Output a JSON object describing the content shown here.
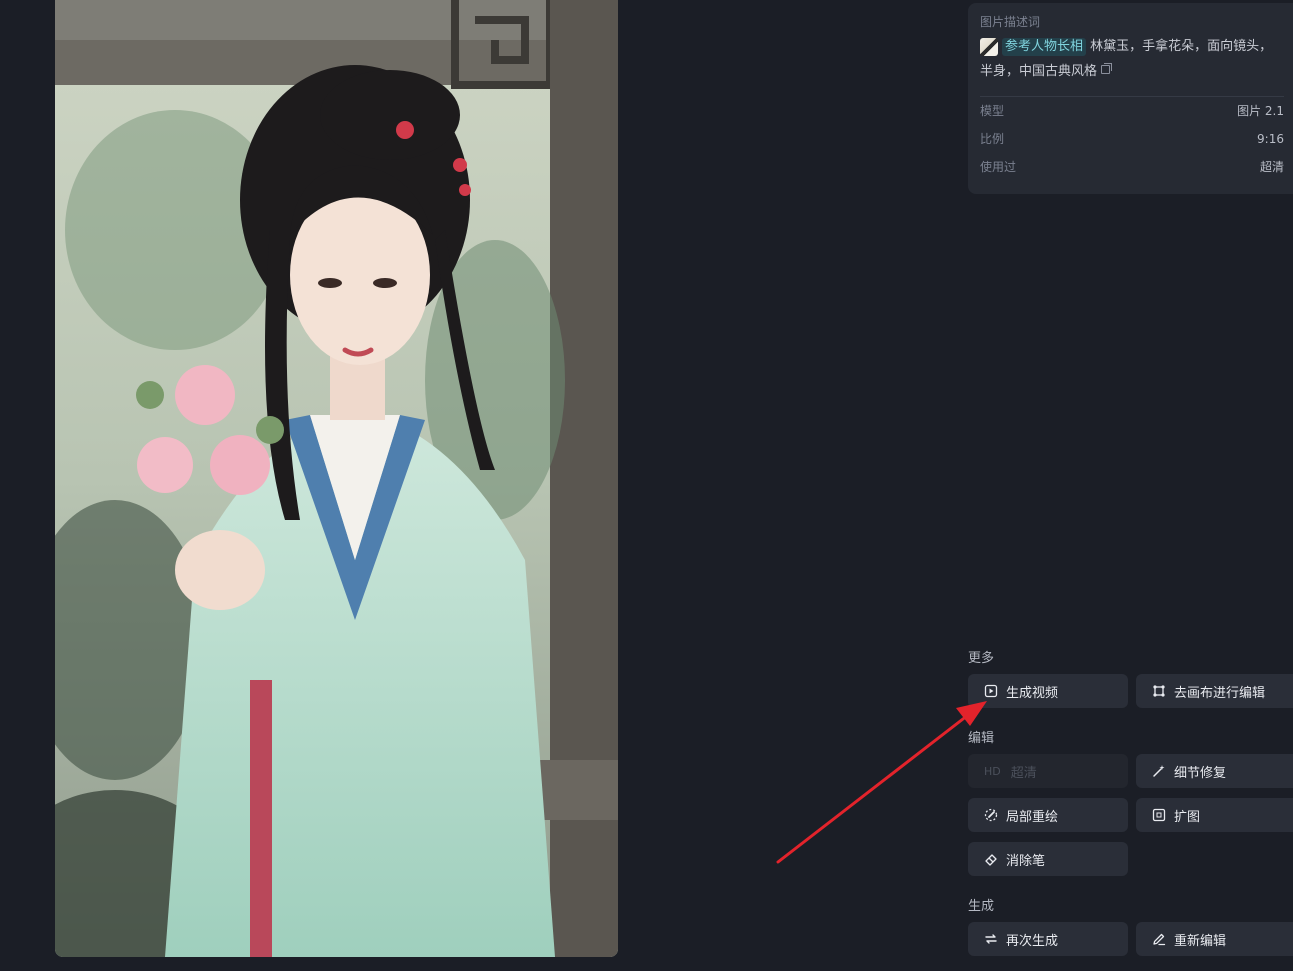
{
  "info": {
    "prompt_caption": "图片描述词",
    "reference_label": "参考人物长相",
    "prompt_line1": "林黛玉，手拿花朵，面向镜头，",
    "prompt_line2": "半身，中国古典风格",
    "rows": [
      {
        "label": "模型",
        "value": "图片 2.1"
      },
      {
        "label": "比例",
        "value": "9:16"
      },
      {
        "label": "使用过",
        "value": "超清"
      }
    ]
  },
  "sections": {
    "more": "更多",
    "edit": "编辑",
    "generate": "生成"
  },
  "buttons": {
    "generate_video": "生成视频",
    "canvas_edit": "去画布进行编辑",
    "hd_badge": "HD",
    "upscale": "超清",
    "detail_fix": "细节修复",
    "inpaint": "局部重绘",
    "outpaint": "扩图",
    "eraser": "消除笔",
    "regenerate": "再次生成",
    "re_edit": "重新编辑"
  },
  "colors": {
    "background": "#1b1e26",
    "card": "#262a33",
    "button": "#2a2e38",
    "reference_accent": "#7fd3dd",
    "annotation_arrow": "#e3232b"
  }
}
